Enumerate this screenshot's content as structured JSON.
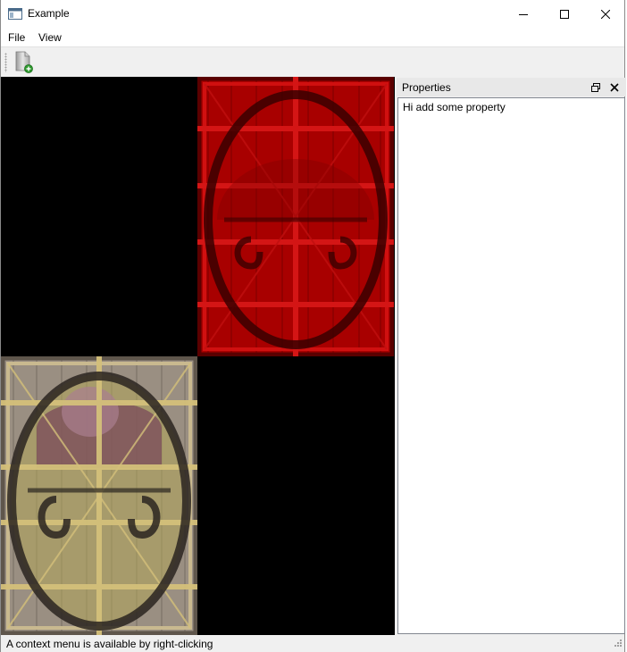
{
  "window": {
    "title": "Example",
    "icon": "app-window-icon"
  },
  "title_buttons": {
    "minimize": "minimize-icon",
    "maximize": "maximize-icon",
    "close": "close-icon"
  },
  "menu": {
    "items": [
      {
        "label": "File"
      },
      {
        "label": "View"
      }
    ]
  },
  "toolbar": {
    "new_icon": "new-document-icon"
  },
  "central": {
    "background": "#000000",
    "tiles": [
      {
        "name": "red-crate-texture",
        "tint": "#b00000"
      },
      {
        "name": "wood-crate-texture",
        "tint": "#b9a98e"
      }
    ]
  },
  "dock": {
    "title": "Properties",
    "float_icon": "float-icon",
    "close_icon": "close-icon",
    "content": "Hi add some property"
  },
  "statusbar": {
    "message": "A context menu is available by right-clicking"
  }
}
